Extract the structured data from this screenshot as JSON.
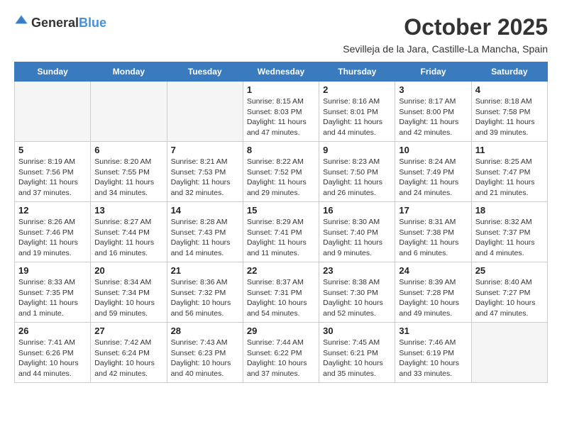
{
  "header": {
    "logo_general": "General",
    "logo_blue": "Blue",
    "title": "October 2025",
    "subtitle": "Sevilleja de la Jara, Castille-La Mancha, Spain"
  },
  "days_of_week": [
    "Sunday",
    "Monday",
    "Tuesday",
    "Wednesday",
    "Thursday",
    "Friday",
    "Saturday"
  ],
  "weeks": [
    [
      {
        "day": "",
        "empty": true
      },
      {
        "day": "",
        "empty": true
      },
      {
        "day": "",
        "empty": true
      },
      {
        "day": "1",
        "sunrise": "8:15 AM",
        "sunset": "8:03 PM",
        "daylight": "11 hours and 47 minutes."
      },
      {
        "day": "2",
        "sunrise": "8:16 AM",
        "sunset": "8:01 PM",
        "daylight": "11 hours and 44 minutes."
      },
      {
        "day": "3",
        "sunrise": "8:17 AM",
        "sunset": "8:00 PM",
        "daylight": "11 hours and 42 minutes."
      },
      {
        "day": "4",
        "sunrise": "8:18 AM",
        "sunset": "7:58 PM",
        "daylight": "11 hours and 39 minutes."
      }
    ],
    [
      {
        "day": "5",
        "sunrise": "8:19 AM",
        "sunset": "7:56 PM",
        "daylight": "11 hours and 37 minutes."
      },
      {
        "day": "6",
        "sunrise": "8:20 AM",
        "sunset": "7:55 PM",
        "daylight": "11 hours and 34 minutes."
      },
      {
        "day": "7",
        "sunrise": "8:21 AM",
        "sunset": "7:53 PM",
        "daylight": "11 hours and 32 minutes."
      },
      {
        "day": "8",
        "sunrise": "8:22 AM",
        "sunset": "7:52 PM",
        "daylight": "11 hours and 29 minutes."
      },
      {
        "day": "9",
        "sunrise": "8:23 AM",
        "sunset": "7:50 PM",
        "daylight": "11 hours and 26 minutes."
      },
      {
        "day": "10",
        "sunrise": "8:24 AM",
        "sunset": "7:49 PM",
        "daylight": "11 hours and 24 minutes."
      },
      {
        "day": "11",
        "sunrise": "8:25 AM",
        "sunset": "7:47 PM",
        "daylight": "11 hours and 21 minutes."
      }
    ],
    [
      {
        "day": "12",
        "sunrise": "8:26 AM",
        "sunset": "7:46 PM",
        "daylight": "11 hours and 19 minutes."
      },
      {
        "day": "13",
        "sunrise": "8:27 AM",
        "sunset": "7:44 PM",
        "daylight": "11 hours and 16 minutes."
      },
      {
        "day": "14",
        "sunrise": "8:28 AM",
        "sunset": "7:43 PM",
        "daylight": "11 hours and 14 minutes."
      },
      {
        "day": "15",
        "sunrise": "8:29 AM",
        "sunset": "7:41 PM",
        "daylight": "11 hours and 11 minutes."
      },
      {
        "day": "16",
        "sunrise": "8:30 AM",
        "sunset": "7:40 PM",
        "daylight": "11 hours and 9 minutes."
      },
      {
        "day": "17",
        "sunrise": "8:31 AM",
        "sunset": "7:38 PM",
        "daylight": "11 hours and 6 minutes."
      },
      {
        "day": "18",
        "sunrise": "8:32 AM",
        "sunset": "7:37 PM",
        "daylight": "11 hours and 4 minutes."
      }
    ],
    [
      {
        "day": "19",
        "sunrise": "8:33 AM",
        "sunset": "7:35 PM",
        "daylight": "11 hours and 1 minute."
      },
      {
        "day": "20",
        "sunrise": "8:34 AM",
        "sunset": "7:34 PM",
        "daylight": "10 hours and 59 minutes."
      },
      {
        "day": "21",
        "sunrise": "8:36 AM",
        "sunset": "7:32 PM",
        "daylight": "10 hours and 56 minutes."
      },
      {
        "day": "22",
        "sunrise": "8:37 AM",
        "sunset": "7:31 PM",
        "daylight": "10 hours and 54 minutes."
      },
      {
        "day": "23",
        "sunrise": "8:38 AM",
        "sunset": "7:30 PM",
        "daylight": "10 hours and 52 minutes."
      },
      {
        "day": "24",
        "sunrise": "8:39 AM",
        "sunset": "7:28 PM",
        "daylight": "10 hours and 49 minutes."
      },
      {
        "day": "25",
        "sunrise": "8:40 AM",
        "sunset": "7:27 PM",
        "daylight": "10 hours and 47 minutes."
      }
    ],
    [
      {
        "day": "26",
        "sunrise": "7:41 AM",
        "sunset": "6:26 PM",
        "daylight": "10 hours and 44 minutes."
      },
      {
        "day": "27",
        "sunrise": "7:42 AM",
        "sunset": "6:24 PM",
        "daylight": "10 hours and 42 minutes."
      },
      {
        "day": "28",
        "sunrise": "7:43 AM",
        "sunset": "6:23 PM",
        "daylight": "10 hours and 40 minutes."
      },
      {
        "day": "29",
        "sunrise": "7:44 AM",
        "sunset": "6:22 PM",
        "daylight": "10 hours and 37 minutes."
      },
      {
        "day": "30",
        "sunrise": "7:45 AM",
        "sunset": "6:21 PM",
        "daylight": "10 hours and 35 minutes."
      },
      {
        "day": "31",
        "sunrise": "7:46 AM",
        "sunset": "6:19 PM",
        "daylight": "10 hours and 33 minutes."
      },
      {
        "day": "",
        "empty": true
      }
    ]
  ],
  "labels": {
    "sunrise": "Sunrise:",
    "sunset": "Sunset:",
    "daylight": "Daylight:"
  }
}
